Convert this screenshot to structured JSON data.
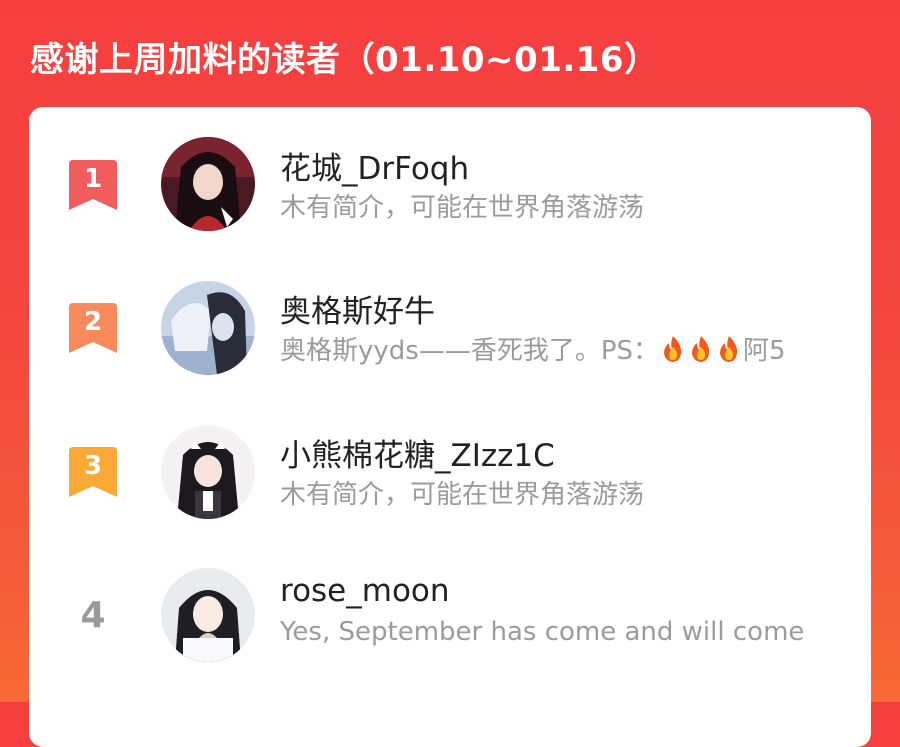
{
  "header": {
    "title": "感谢上周加料的读者（01.10~01.16）"
  },
  "readers": [
    {
      "rank": "1",
      "name": "花城_DrFoqh",
      "bio": "木有简介，可能在世界角落游荡"
    },
    {
      "rank": "2",
      "name": "奥格斯好牛",
      "bio_before": "奥格斯yyds——香死我了。PS：",
      "bio_emoji": "fire-icon",
      "bio_emoji_count": 3,
      "bio_after": "阿5"
    },
    {
      "rank": "3",
      "name": "小熊棉花糖_ZIzz1C",
      "bio": "木有简介，可能在世界角落游荡"
    },
    {
      "rank": "4",
      "name": "rose_moon",
      "bio": "Yes, September has come and will come"
    }
  ],
  "colors": {
    "rank1": "#f15d5d",
    "rank2": "#f98a5c",
    "rank3": "#fba936",
    "rank_plain": "#9a9a9a"
  }
}
